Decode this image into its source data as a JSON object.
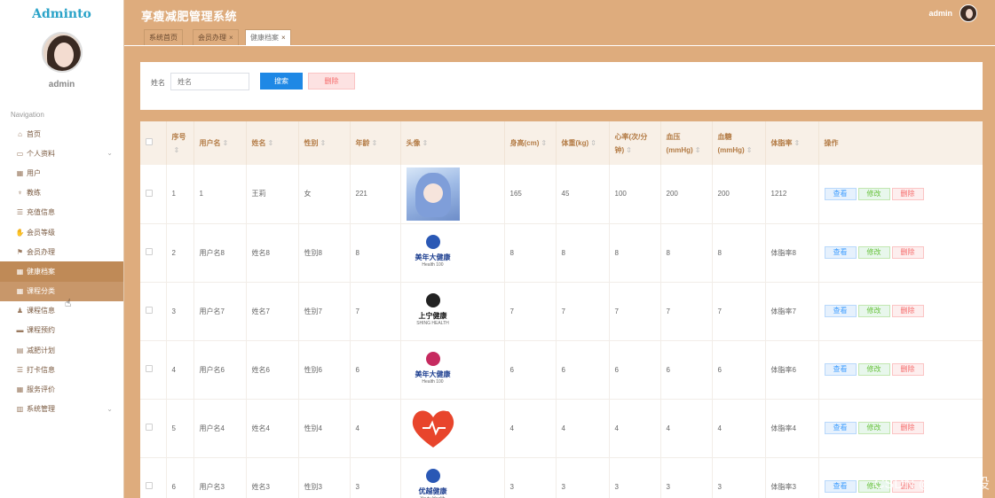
{
  "app": {
    "logo": "Adminto",
    "title": "享瘦减肥管理系统"
  },
  "sidebar": {
    "username": "admin",
    "nav_heading": "Navigation",
    "items": [
      {
        "label": "首页",
        "icon": "home-icon"
      },
      {
        "label": "个人资料",
        "icon": "profile-icon",
        "caret": "⌄"
      },
      {
        "label": "用户",
        "icon": "grid-icon"
      },
      {
        "label": "教练",
        "icon": "trophy-icon"
      },
      {
        "label": "充值信息",
        "icon": "list-icon"
      },
      {
        "label": "会员等级",
        "icon": "thumb-icon"
      },
      {
        "label": "会员办理",
        "icon": "flag-icon"
      },
      {
        "label": "健康档案",
        "icon": "grid-icon"
      },
      {
        "label": "课程分类",
        "icon": "grid-icon"
      },
      {
        "label": "课程信息",
        "icon": "user-icon"
      },
      {
        "label": "课程预约",
        "icon": "laptop-icon"
      },
      {
        "label": "减肥计划",
        "icon": "chart-icon"
      },
      {
        "label": "打卡信息",
        "icon": "list-icon"
      },
      {
        "label": "服务评价",
        "icon": "grid-icon"
      },
      {
        "label": "系统管理",
        "icon": "bar-chart-icon",
        "caret": "⌄"
      }
    ]
  },
  "header": {
    "user": "admin"
  },
  "tabs": [
    {
      "label": "系统首页"
    },
    {
      "label": "会员办理",
      "close": "×"
    },
    {
      "label": "健康档案",
      "close": "×"
    }
  ],
  "search": {
    "label": "姓名",
    "placeholder": "姓名",
    "search_btn": "搜索",
    "delete_btn": "删除"
  },
  "table": {
    "headers": [
      "序号",
      "用户名",
      "姓名",
      "性别",
      "年龄",
      "头像",
      "身高(cm)",
      "体重(kg)",
      "心率(次/分钟)",
      "血压(mmHg)",
      "血糖(mmHg)",
      "体脂率",
      "操作"
    ],
    "actions": {
      "view": "查看",
      "edit": "修改",
      "delete": "删除"
    },
    "rows": [
      {
        "no": "1",
        "username": "1",
        "name": "王莉",
        "gender": "女",
        "age": "221",
        "height": "165",
        "weight": "45",
        "heart": "100",
        "bp": "200",
        "sugar": "200",
        "fat": "1212",
        "img": "anime"
      },
      {
        "no": "2",
        "username": "用户名8",
        "name": "姓名8",
        "gender": "性别8",
        "age": "8",
        "height": "8",
        "weight": "8",
        "heart": "8",
        "bp": "8",
        "sugar": "8",
        "fat": "体脂率8",
        "img": "logo1",
        "logo_main": "美年大健康",
        "logo_sub": "Health 100"
      },
      {
        "no": "3",
        "username": "用户名7",
        "name": "姓名7",
        "gender": "性别7",
        "age": "7",
        "height": "7",
        "weight": "7",
        "heart": "7",
        "bp": "7",
        "sugar": "7",
        "fat": "体脂率7",
        "img": "logo2",
        "logo_main": "上宁健康",
        "logo_sub": "SHING HEALTH"
      },
      {
        "no": "4",
        "username": "用户名6",
        "name": "姓名6",
        "gender": "性别6",
        "age": "6",
        "height": "6",
        "weight": "6",
        "heart": "6",
        "bp": "6",
        "sugar": "6",
        "fat": "体脂率6",
        "img": "logo3",
        "logo_main": "美年大健康",
        "logo_sub": "Health 100"
      },
      {
        "no": "5",
        "username": "用户名4",
        "name": "姓名4",
        "gender": "性别4",
        "age": "4",
        "height": "4",
        "weight": "4",
        "heart": "4",
        "bp": "4",
        "sugar": "4",
        "fat": "体脂率4",
        "img": "heart"
      },
      {
        "no": "6",
        "username": "用户名3",
        "name": "姓名3",
        "gender": "性别3",
        "age": "3",
        "height": "3",
        "weight": "3",
        "heart": "3",
        "bp": "3",
        "sugar": "3",
        "fat": "体脂率3",
        "img": "logo4",
        "logo_main": "优越健康",
        "logo_sub": "Youty Health"
      }
    ]
  },
  "watermark": "CSDN @一点毕设",
  "colors": {
    "theme": "#deac7d",
    "active_nav": "#bf8a57",
    "primary": "#1e88e5"
  }
}
